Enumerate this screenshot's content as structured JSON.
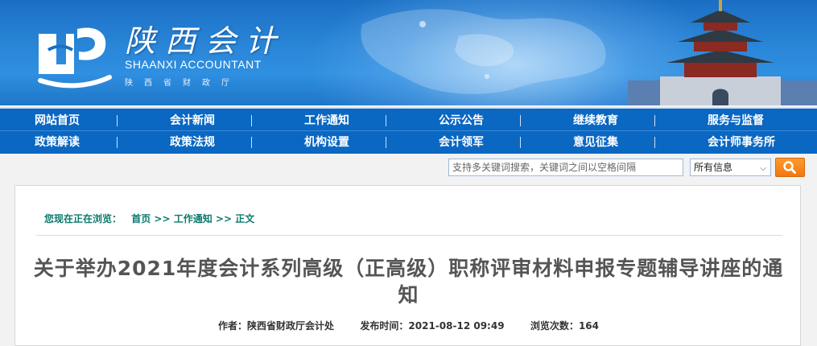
{
  "banner": {
    "logo_cn": "陕西会计",
    "logo_en": "SHAANXI ACCOUNTANT",
    "logo_sub": "陕西省财政厅"
  },
  "nav": {
    "row1": [
      "网站首页",
      "会计新闻",
      "工作通知",
      "公示公告",
      "继续教育",
      "服务与监督"
    ],
    "row2": [
      "政策解读",
      "政策法规",
      "机构设置",
      "会计领军",
      "意见征集",
      "会计师事务所"
    ]
  },
  "search": {
    "placeholder": "支持多关键词搜索，关键词之间以空格间隔",
    "scope_selected": "所有信息",
    "button_icon": "search-icon"
  },
  "breadcrumb": {
    "prefix": "您现在正在浏览：",
    "items": [
      "首页",
      "工作通知",
      "正文"
    ],
    "separator": ">>"
  },
  "article": {
    "title": "关于举办2021年度会计系列高级（正高级）职称评审材料申报专题辅导讲座的通知",
    "author_label": "作者：",
    "author": "陕西省财政厅会计处",
    "time_label": "发布时间：",
    "time": "2021-08-12 09:49",
    "views_label": "浏览次数：",
    "views": "164"
  },
  "colors": {
    "nav_bg": "#0a67c2",
    "breadcrumb": "#0c7a6e",
    "search_button": "#f07810",
    "title": "#555555"
  }
}
